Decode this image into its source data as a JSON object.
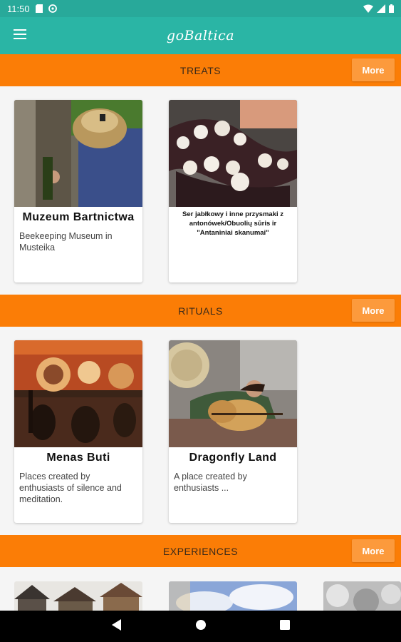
{
  "status_bar": {
    "time": "11:50"
  },
  "app_bar": {
    "title": "goBaltica"
  },
  "sections": [
    {
      "title": "TREATS",
      "more_label": "More",
      "cards": [
        {
          "title": "Muzeum Bartnictwa",
          "description": "Beekeeping Museum in Musteika"
        },
        {
          "title": "Ser jabłkowy i inne przysmaki z antonówek/Obuolių sūris ir \"Antaniniai skanumai\"",
          "description": ""
        }
      ]
    },
    {
      "title": "RITUALS",
      "more_label": "More",
      "cards": [
        {
          "title": "Menas Buti",
          "description": "Places created by enthusiasts of silence and meditation."
        },
        {
          "title": "Dragonfly Land",
          "description": "A place created by enthusiasts ..."
        }
      ]
    },
    {
      "title": "EXPERIENCES",
      "more_label": "More"
    }
  ],
  "icons": {
    "menu": "menu-icon",
    "back": "back-icon",
    "home": "home-icon",
    "recents": "recents-icon"
  }
}
